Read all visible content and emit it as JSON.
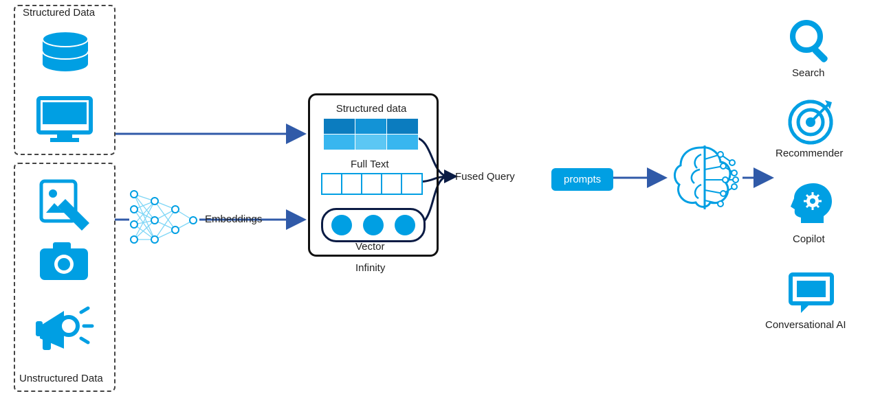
{
  "inputs": {
    "structured": "Structured Data",
    "unstructured": "Unstructured Data",
    "data_types": [
      "database",
      "monitor",
      "document-image",
      "camera-photo",
      "megaphone-audio"
    ]
  },
  "embeddings_label": "Embeddings",
  "infinity": {
    "name": "Infinity",
    "structured_data_label": "Structured data",
    "full_text_label": "Full Text",
    "vector_label": "Vector"
  },
  "fused_query_label": "Fused Query",
  "prompts_label": "prompts",
  "llm_icon": "brain-network",
  "outputs": [
    {
      "name": "Search",
      "icon": "search-icon"
    },
    {
      "name": "Recommender",
      "icon": "target-icon"
    },
    {
      "name": "Copilot",
      "icon": "head-gear-icon"
    },
    {
      "name": "Conversational AI",
      "icon": "chat-icon"
    }
  ],
  "colors": {
    "blue": "#009fe3",
    "dark": "#0a1b44",
    "accent": "#305aa8"
  }
}
